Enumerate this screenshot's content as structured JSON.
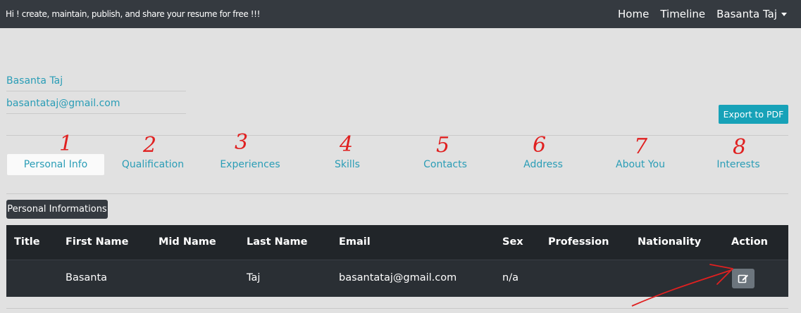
{
  "navbar": {
    "brand": "Hi ! create, maintain, publish, and share your resume for free !!!",
    "links": [
      "Home",
      "Timeline",
      "Basanta Taj"
    ]
  },
  "user": {
    "name": "Basanta Taj",
    "email": "basantataj@gmail.com"
  },
  "export_label": "Export to PDF",
  "tabs": [
    {
      "label": "Personal Info",
      "number": "1"
    },
    {
      "label": "Qualification",
      "number": "2"
    },
    {
      "label": "Experiences",
      "number": "3"
    },
    {
      "label": "Skills",
      "number": "4"
    },
    {
      "label": "Contacts",
      "number": "5"
    },
    {
      "label": "Address",
      "number": "6"
    },
    {
      "label": "About You",
      "number": "7"
    },
    {
      "label": "Interests",
      "number": "8"
    }
  ],
  "section_title": "Personal Informations",
  "table": {
    "headers": [
      "Title",
      "First Name",
      "Mid Name",
      "Last Name",
      "Email",
      "Sex",
      "Profession",
      "Nationality",
      "Action"
    ],
    "rows": [
      [
        "",
        "Basanta",
        "",
        "Taj",
        "basantataj@gmail.com",
        "n/a",
        "",
        ""
      ]
    ]
  },
  "colors": {
    "accent": "#17a2b8",
    "link": "#2a9db6",
    "dark": "#212529",
    "annotation": "#e02020"
  },
  "icons": {
    "edit": "edit-icon",
    "dropdown": "caret-down-icon"
  }
}
